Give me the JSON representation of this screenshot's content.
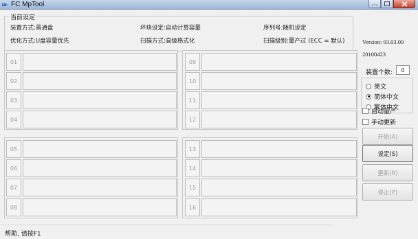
{
  "window": {
    "title": "FC MpTool"
  },
  "settings": {
    "legend": "当前设定",
    "items": [
      {
        "label": "装置方式:",
        "value": "普通盘"
      },
      {
        "label": "坏块设定:",
        "value": "自动计算容量"
      },
      {
        "label": "序列号:",
        "value": "随机设定"
      },
      {
        "label": "优化方式:",
        "value": "U盘容量优先"
      },
      {
        "label": "扫描方式:",
        "value": "高级格式化"
      },
      {
        "label": "扫描级别:",
        "value": "量产过 (ECC = 默认)"
      }
    ]
  },
  "slots": {
    "left_top": [
      "01",
      "02",
      "03",
      "04"
    ],
    "right_top": [
      "09",
      "10",
      "11",
      "12"
    ],
    "left_bottom": [
      "05",
      "06",
      "07",
      "08"
    ],
    "right_bottom": [
      "13",
      "14",
      "15",
      "16"
    ]
  },
  "info": {
    "version": "Version: 03.03.00",
    "date": "20100423",
    "device_count_label": "装置个数:",
    "device_count": "0"
  },
  "language": {
    "options": [
      {
        "label": "英文",
        "selected": false
      },
      {
        "label": "简体中文",
        "selected": true
      },
      {
        "label": "繁体中文",
        "selected": false
      }
    ]
  },
  "options": {
    "auto_produce": "自动量产",
    "manual_update": "手动更新"
  },
  "buttons": {
    "start": "开始(A)",
    "settings": "设定(S)",
    "update": "更新(R)",
    "stop": "停止(P)"
  },
  "status": {
    "text": "帮助, 请按F1"
  }
}
